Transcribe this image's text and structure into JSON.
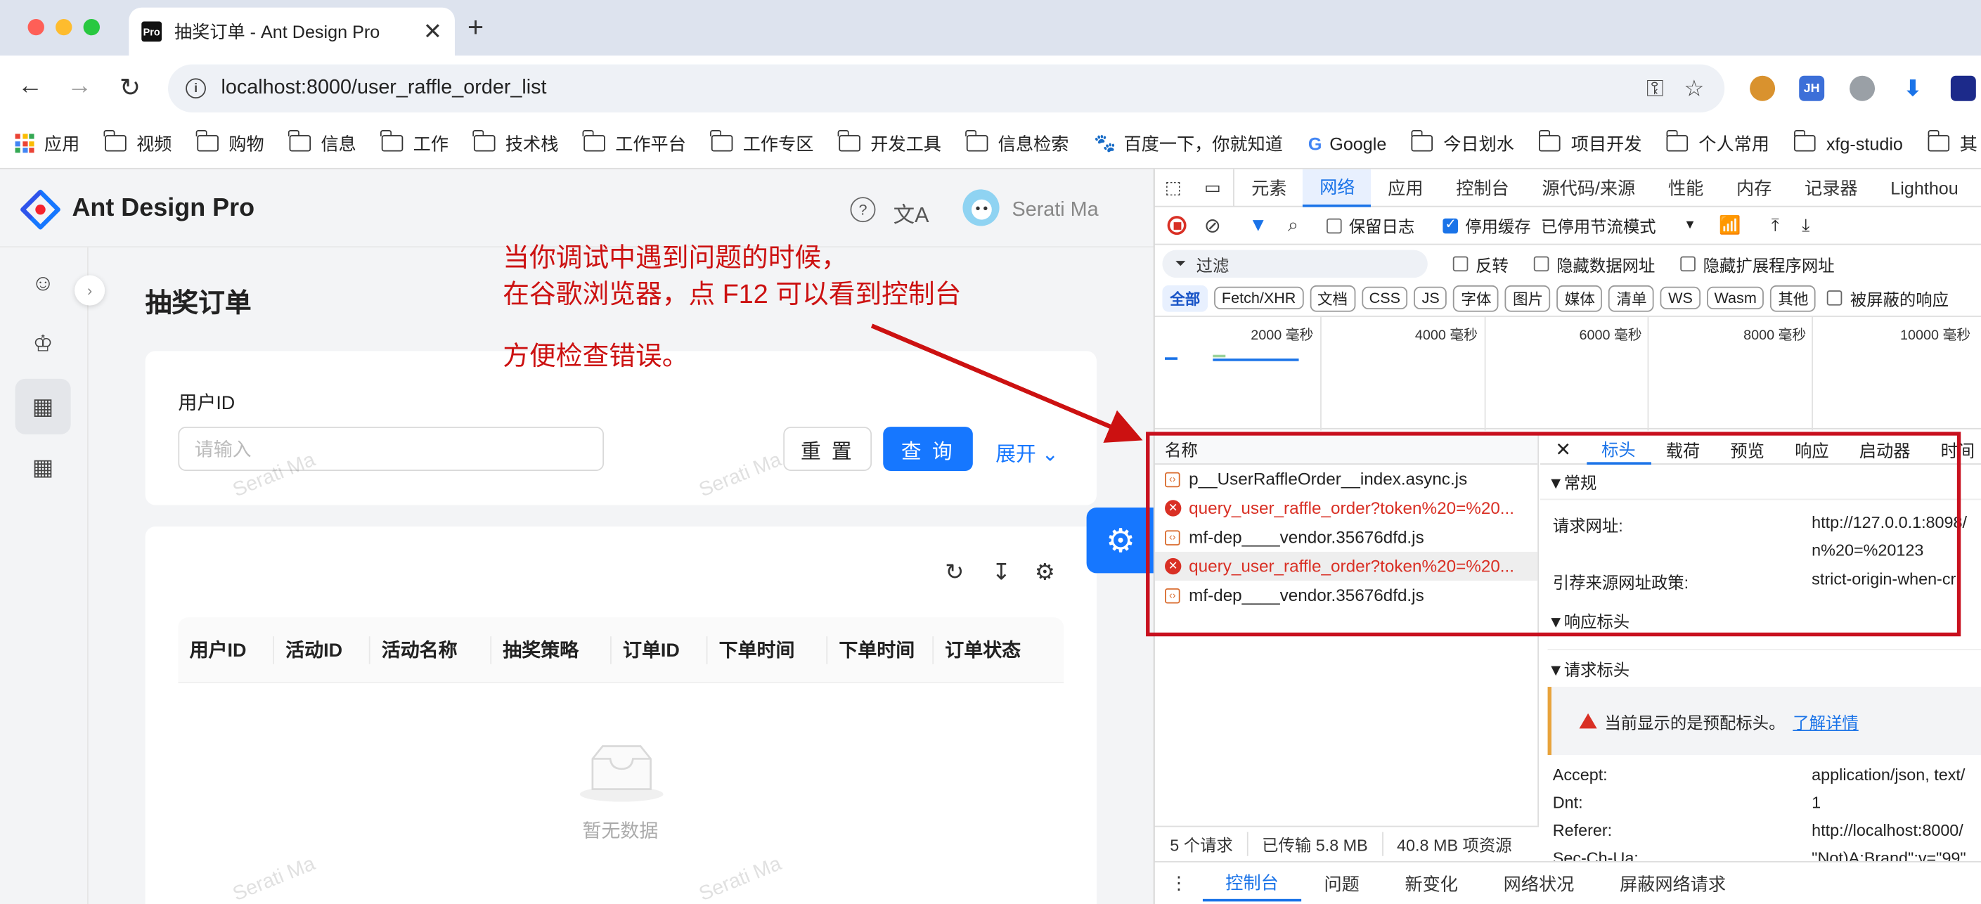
{
  "browser": {
    "tab_title": "抽奖订单 - Ant Design Pro",
    "tab_favicon": "Pro",
    "url": "localhost:8000/user_raffle_order_list",
    "extensions": [
      "cookie-icon",
      "JH",
      "shield-icon",
      "download-icon",
      "puzzle-icon"
    ],
    "bookmarks": [
      "应用",
      "视频",
      "购物",
      "信息",
      "工作",
      "技术栈",
      "工作平台",
      "工作专区",
      "开发工具",
      "信息检索",
      "百度一下，你就知道",
      "Google",
      "今日划水",
      "项目开发",
      "个人常用",
      "xfg-studio",
      "其"
    ]
  },
  "app": {
    "brand": "Ant Design Pro",
    "username": "Serati Ma",
    "page_title": "抽奖订单",
    "search": {
      "label": "用户ID",
      "placeholder": "请输入",
      "reset": "重 置",
      "query": "查 询",
      "expand": "展开"
    },
    "table": {
      "columns": [
        "用户ID",
        "活动ID",
        "活动名称",
        "抽奖策略",
        "订单ID",
        "下单时间",
        "下单时间",
        "订单状态"
      ],
      "empty_text": "暂无数据"
    },
    "watermark": "Serati Ma"
  },
  "devtools": {
    "tabs": [
      "元素",
      "网络",
      "应用",
      "控制台",
      "源代码/来源",
      "性能",
      "内存",
      "记录器",
      "Lighthou"
    ],
    "active_tab": "网络",
    "toolbar": {
      "preserve_log": "保留日志",
      "disable_cache": "停用缓存",
      "throttle": "已停用节流模式"
    },
    "filter": {
      "placeholder": "过滤",
      "invert": "反转",
      "hide_data_urls": "隐藏数据网址",
      "hide_ext_urls": "隐藏扩展程序网址"
    },
    "type_filters": [
      "全部",
      "Fetch/XHR",
      "文档",
      "CSS",
      "JS",
      "字体",
      "图片",
      "媒体",
      "清单",
      "WS",
      "Wasm",
      "其他"
    ],
    "blocked_label": "被屏蔽的响应",
    "timeline_ticks": [
      "2000 毫秒",
      "4000 毫秒",
      "6000 毫秒",
      "8000 毫秒",
      "10000 毫秒"
    ],
    "requests_header": "名称",
    "requests": [
      {
        "name": "p__UserRaffleOrder__index.async.js",
        "error": false
      },
      {
        "name": "query_user_raffle_order?token%20=%20...",
        "error": true
      },
      {
        "name": "mf-dep____vendor.35676dfd.js",
        "error": false
      },
      {
        "name": "query_user_raffle_order?token%20=%20...",
        "error": true
      },
      {
        "name": "mf-dep____vendor.35676dfd.js",
        "error": false
      }
    ],
    "status": [
      "5 个请求",
      "已传输 5.8 MB",
      "40.8 MB 项资源"
    ],
    "detail_tabs": [
      "标头",
      "载荷",
      "预览",
      "响应",
      "启动器",
      "时间"
    ],
    "general_section": "▼常规",
    "request_url_label": "请求网址:",
    "request_url_value": "http://127.0.0.1:8098/",
    "request_url_value2": "n%20=%20123",
    "referrer_policy_label": "引荐来源网址政策:",
    "referrer_policy_value": "strict-origin-when-cr",
    "response_headers": "▼响应标头",
    "request_headers": "▼请求标头",
    "provisional_warning": "当前显示的是预配标头。",
    "learn_more": "了解详情",
    "headers": [
      {
        "k": "Accept:",
        "v": "application/json, text/"
      },
      {
        "k": "Dnt:",
        "v": "1"
      },
      {
        "k": "Referer:",
        "v": "http://localhost:8000/"
      },
      {
        "k": "Sec-Ch-Ua:",
        "v": "\"Not)A;Brand\";v=\"99\""
      }
    ],
    "drawer_tabs": [
      "控制台",
      "问题",
      "新变化",
      "网络状况",
      "屏蔽网络请求"
    ]
  },
  "annotation": {
    "line1": "当你调试中遇到问题的时候，",
    "line2": "在谷歌浏览器，点 F12 可以看到控制台",
    "line3": "方便检查错误。",
    "color": "#cc1111"
  }
}
